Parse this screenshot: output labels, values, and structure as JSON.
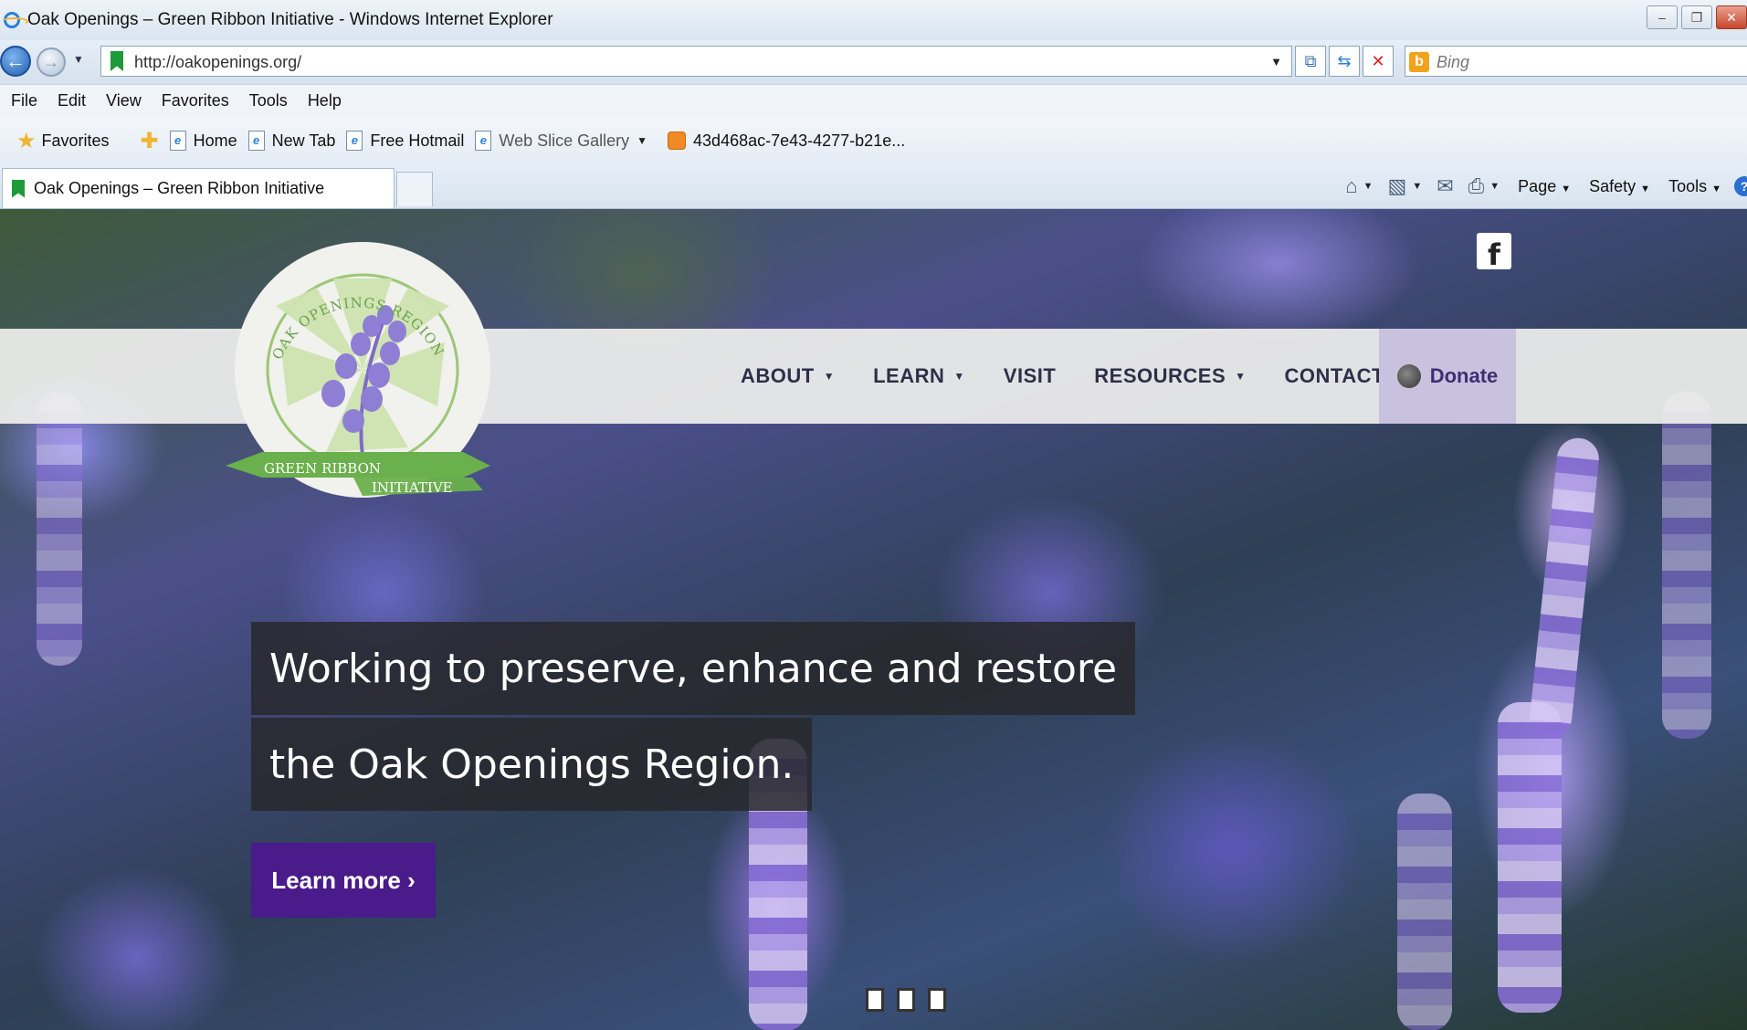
{
  "window": {
    "title": "Oak Openings – Green Ribbon Initiative - Windows Internet Explorer",
    "controls": [
      "–",
      "❐",
      "✕"
    ]
  },
  "address": {
    "url": "http://oakopenings.org/",
    "search_placeholder": "Bing"
  },
  "menu": [
    "File",
    "Edit",
    "View",
    "Favorites",
    "Tools",
    "Help"
  ],
  "favorites_bar": {
    "favorites_label": "Favorites",
    "links": [
      {
        "label": "Home",
        "icon": "ie-page-icon"
      },
      {
        "label": "New Tab",
        "icon": "ie-page-icon"
      },
      {
        "label": "Free Hotmail",
        "icon": "ie-page-icon"
      },
      {
        "label": "Web Slice Gallery",
        "icon": "ie-page-icon"
      },
      {
        "label": "43d468ac-7e43-4277-b21e...",
        "icon": "rss-icon"
      }
    ]
  },
  "tab": {
    "title": "Oak Openings – Green Ribbon Initiative"
  },
  "command_bar": {
    "page": "Page",
    "safety": "Safety",
    "tools": "Tools"
  },
  "site": {
    "logo_text_top": "OAK OPENINGS REGION",
    "logo_text_ribbon_1": "GREEN RIBBON",
    "logo_text_ribbon_2": "INITIATIVE",
    "facebook": "f",
    "nav": [
      {
        "label": "ABOUT",
        "dropdown": true
      },
      {
        "label": "LEARN",
        "dropdown": true
      },
      {
        "label": "VISIT",
        "dropdown": false
      },
      {
        "label": "RESOURCES",
        "dropdown": true
      },
      {
        "label": "CONTACT",
        "dropdown": false
      }
    ],
    "donate": "Donate",
    "hero_line_1": "Working to preserve, enhance and restore",
    "hero_line_2": "the Oak Openings Region.",
    "cta": "Learn more ›",
    "slide_count": 3
  },
  "colors": {
    "nav_text": "#2d3048",
    "donate_bg": "#c9c2df",
    "cta_bg": "#4a1b8a",
    "logo_green": "#7fbf5a",
    "lupine_purple": "#7a68c8"
  }
}
